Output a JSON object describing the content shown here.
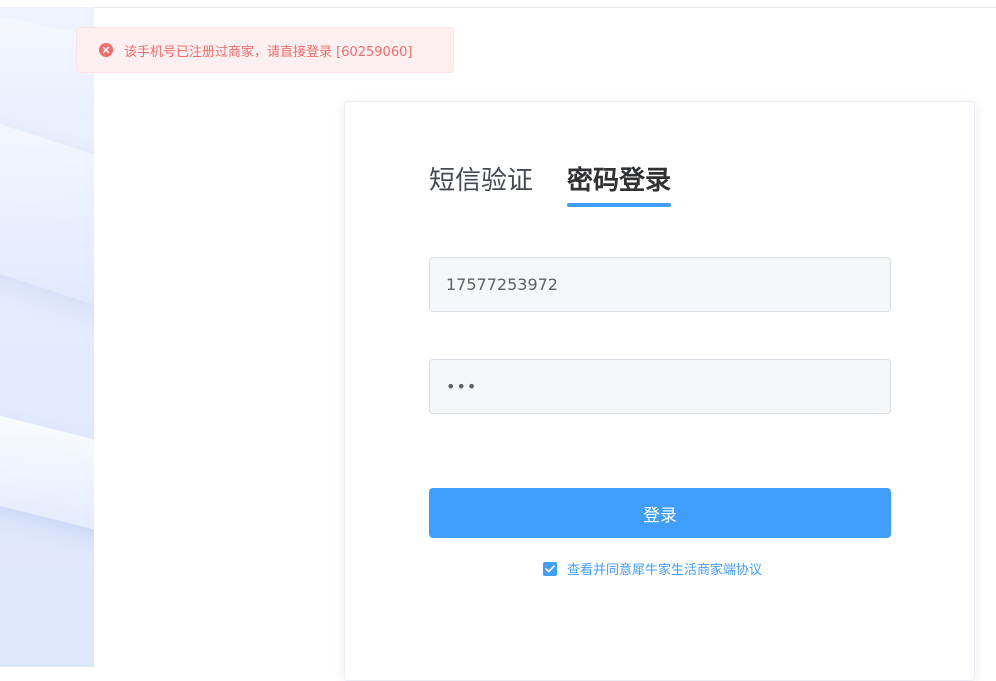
{
  "toast": {
    "message": "该手机号已注册过商家，请直接登录 [60259060]",
    "icon": "error-circle-icon"
  },
  "login": {
    "tabs": [
      {
        "label": "短信验证",
        "active": false
      },
      {
        "label": "密码登录",
        "active": true
      }
    ],
    "phone_value": "17577253972",
    "password_value": "•••",
    "submit_label": "登录",
    "agreement_text": "查看并同意犀牛家生活商家端协议",
    "agreement_checked": true
  },
  "colors": {
    "primary": "#409eff",
    "error": "#f56c6c",
    "error_bg": "#fef0f0"
  }
}
